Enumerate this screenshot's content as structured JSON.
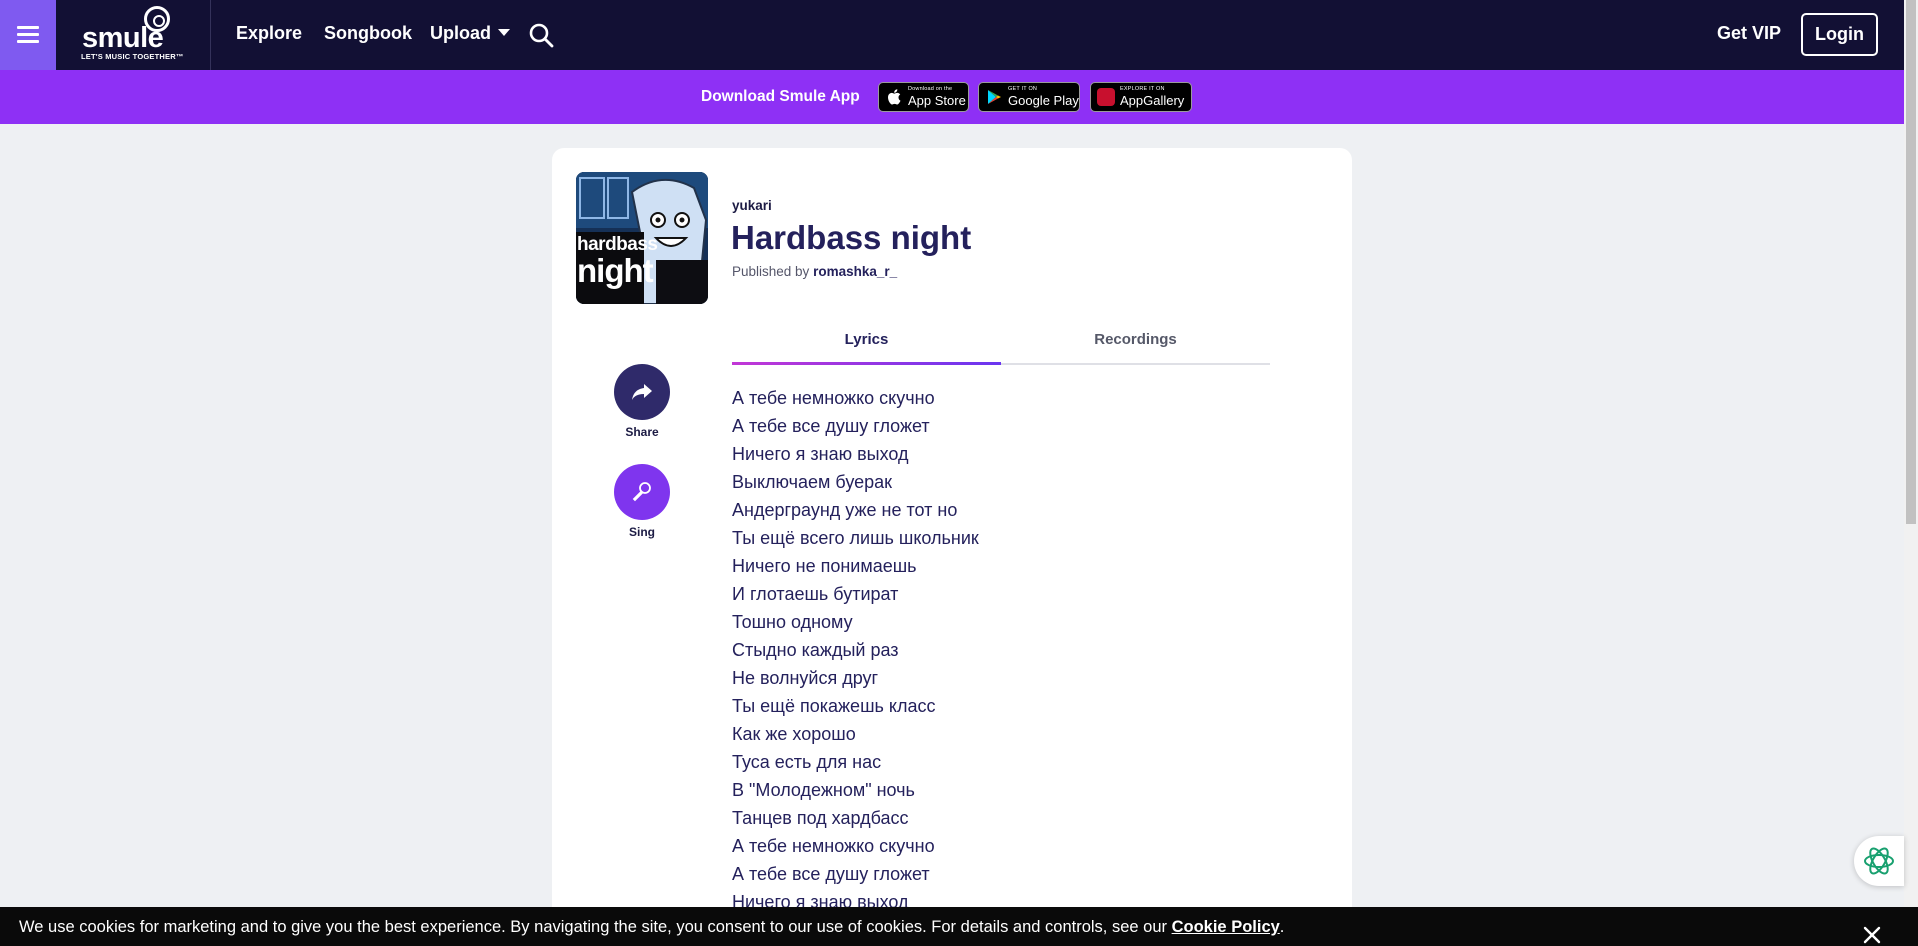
{
  "nav": {
    "logo_word": "smule",
    "logo_tagline": "LET'S MUSIC TOGETHER™",
    "links": [
      "Explore",
      "Songbook",
      "Upload"
    ],
    "get_vip": "Get VIP",
    "login": "Login"
  },
  "download_bar": {
    "text": "Download Smule App",
    "app_store": {
      "small": "Download on the",
      "big": "App Store"
    },
    "google_play": {
      "small": "GET IT ON",
      "big": "Google Play"
    },
    "app_gallery": {
      "small": "EXPLORE IT ON",
      "big": "AppGallery"
    }
  },
  "song": {
    "artist": "yukari",
    "title": "Hardbass night",
    "published_prefix": "Published by",
    "publisher": "romashka_r_",
    "cover_text_1": "hardbass",
    "cover_text_2": "night"
  },
  "tabs": {
    "lyrics": "Lyrics",
    "recordings": "Recordings"
  },
  "actions": {
    "share": "Share",
    "sing": "Sing"
  },
  "lyrics": [
    "А тебе немножко скучно",
    "А тебе все душу гложет",
    "Ничего я знаю выход",
    "Выключаем буерак",
    "Андерграунд уже не тот но",
    "Ты ещё всего лишь школьник",
    "Ничего не понимаешь",
    "И глотаешь бутират",
    "Тошно одному",
    "Стыдно каждый раз",
    "Не волнуйся друг",
    "Ты ещё покажешь класс",
    "Как же хорошо",
    "Туса есть для нас",
    "В \"Молодежном\" ночь",
    "Танцев под хардбасс",
    "А тебе немножко скучно",
    "А тебе все душу гложет",
    "Ничего я знаю выход"
  ],
  "cookie": {
    "text": "We use cookies for marketing and to give you the best experience. By navigating the site, you consent to our use of cookies. For details and controls, see our ",
    "link": "Cookie Policy",
    "suffix": "."
  },
  "icons": {
    "menu": "hamburger-icon",
    "search": "search-icon",
    "share": "share-arrow-icon",
    "sing": "microphone-icon",
    "chat": "chat-assistant-icon",
    "close": "close-icon"
  },
  "colors": {
    "nav_bg": "#121034",
    "menu_bg": "#7f5af0",
    "download_bar_bg": "#8e30f5",
    "page_bg": "#eef0f3",
    "title": "#24215c",
    "share_button": "#2f2a6a",
    "sing_button": "#7f35ee"
  }
}
